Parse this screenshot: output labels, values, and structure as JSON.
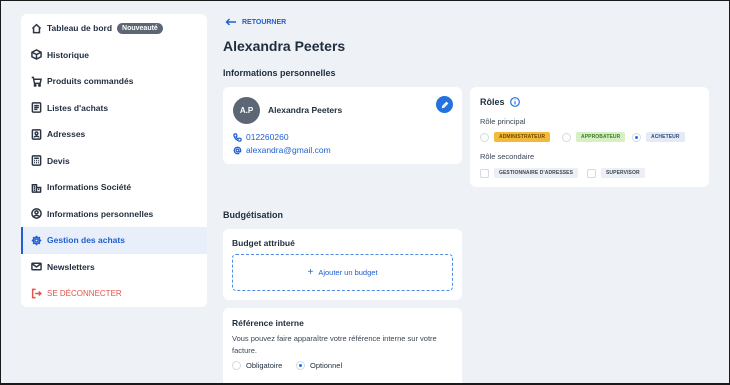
{
  "sidebar": {
    "items": [
      {
        "label": "Tableau de bord",
        "icon": "home-icon",
        "badge": "Nouveauté"
      },
      {
        "label": "Historique",
        "icon": "box-icon"
      },
      {
        "label": "Produits commandés",
        "icon": "cart-icon"
      },
      {
        "label": "Listes d'achats",
        "icon": "list-icon"
      },
      {
        "label": "Adresses",
        "icon": "address-icon"
      },
      {
        "label": "Devis",
        "icon": "calculator-icon"
      },
      {
        "label": "Informations Société",
        "icon": "building-icon"
      },
      {
        "label": "Informations personnelles",
        "icon": "user-icon"
      },
      {
        "label": "Gestion des achats",
        "icon": "gear-icon",
        "active": true
      },
      {
        "label": "Newsletters",
        "icon": "mail-icon"
      },
      {
        "label": "SE DÉCONNECTER",
        "icon": "logout-icon"
      }
    ]
  },
  "header": {
    "back_label": "RETOURNER",
    "title": "Alexandra Peeters"
  },
  "personal": {
    "section_title": "Informations personnelles",
    "initials": "A.P",
    "name": "Alexandra Peeters",
    "phone": "012260260",
    "email": "alexandra@gmail.com"
  },
  "roles": {
    "title": "Rôles",
    "primary_label": "Rôle principal",
    "primary_options": [
      {
        "label": "ADMINISTRATEUR",
        "selected": false,
        "bg": "#f5b93a",
        "color": "#6b4a00"
      },
      {
        "label": "APPROBATEUR",
        "selected": false,
        "bg": "#d6f0c4",
        "color": "#3f7a23"
      },
      {
        "label": "ACHETEUR",
        "selected": true,
        "bg": "#e4ebf7",
        "color": "#2d4d7a"
      }
    ],
    "secondary_label": "Rôle secondaire",
    "secondary_options": [
      {
        "label": "GESTIONNAIRE D'ADRESSES",
        "checked": false
      },
      {
        "label": "SUPERVISOR",
        "checked": false
      }
    ]
  },
  "budget": {
    "section_title": "Budgétisation",
    "card_title": "Budget attribué",
    "add_label": "Ajouter un budget"
  },
  "reference": {
    "title": "Référence interne",
    "description": "Vous pouvez faire apparaître votre référence interne sur votre facture.",
    "options": [
      {
        "label": "Obligatoire",
        "selected": false
      },
      {
        "label": "Optionnel",
        "selected": true
      }
    ]
  },
  "colors": {
    "accent": "#1f5fd0",
    "logout": "#e5534b",
    "background": "#eef1f6"
  }
}
